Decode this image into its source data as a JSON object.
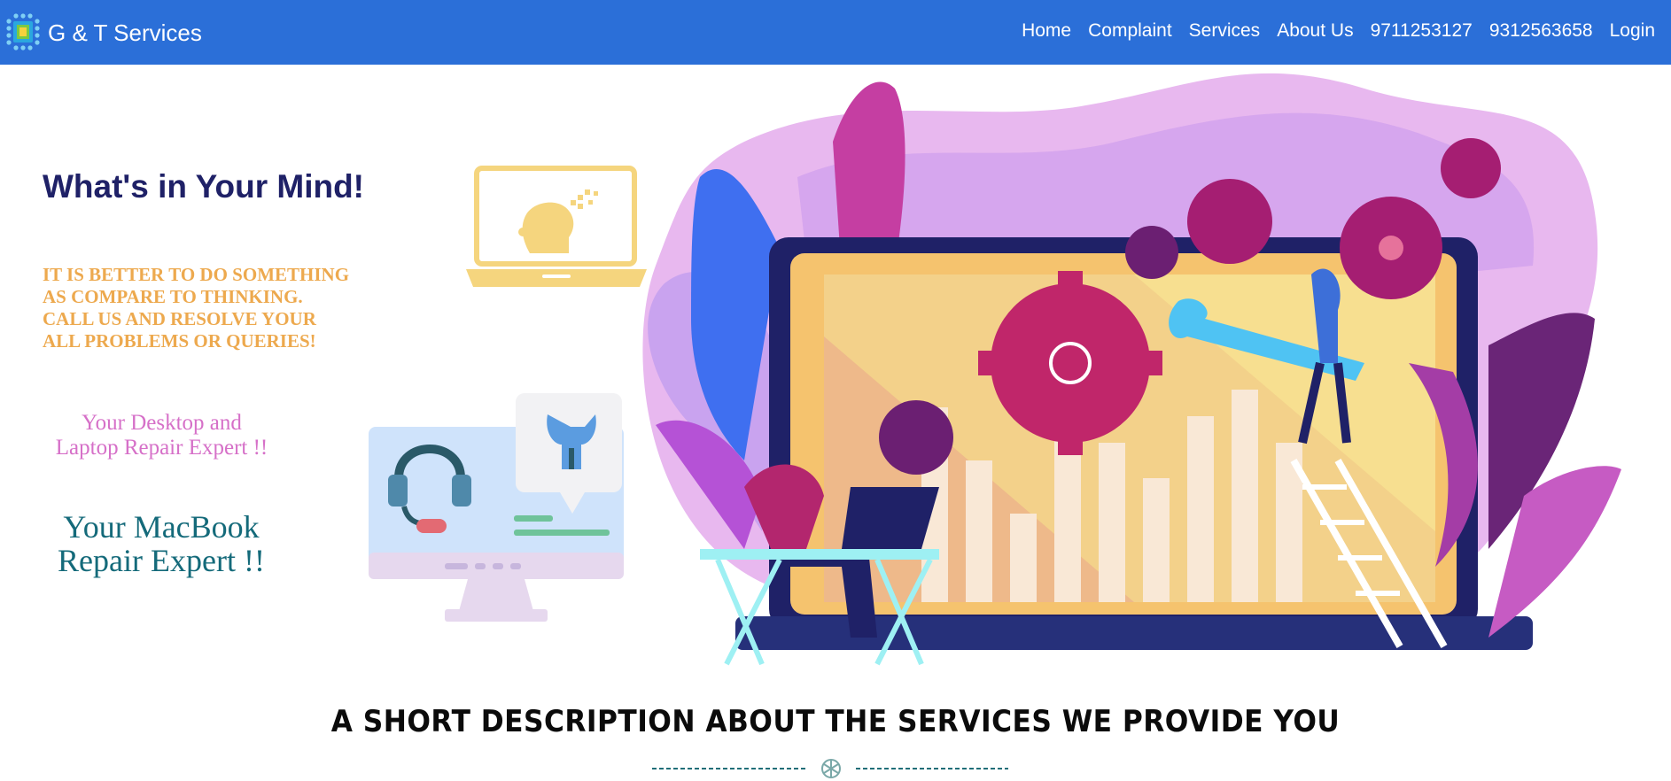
{
  "brand": {
    "name": "G & T Services",
    "logo_icon": "chip-icon"
  },
  "nav": {
    "items": [
      {
        "label": "Home"
      },
      {
        "label": "Complaint"
      },
      {
        "label": "Services"
      },
      {
        "label": "About Us"
      },
      {
        "label": "9711253127"
      },
      {
        "label": "9312563658"
      },
      {
        "label": "Login"
      }
    ]
  },
  "hero": {
    "title": "What's in Your Mind!",
    "quote_lines": [
      "IT IS BETTER TO DO SOMETHING",
      "AS COMPARE TO THINKING.",
      "CALL US AND RESOLVE YOUR",
      "ALL PROBLEMS OR QUERIES!"
    ],
    "expert_line1": [
      "Your Desktop and",
      "Laptop Repair Expert !!"
    ],
    "expert_line2": [
      "Your MacBook",
      "Repair Expert !!"
    ]
  },
  "section": {
    "heading": "A SHORT DESCRIPTION ABOUT THE SERVICES WE PROVIDE YOU",
    "divider_icon": "snowflake-icon"
  },
  "colors": {
    "navbar": "#2b6fd8",
    "title": "#1f2167",
    "quote": "#eda94e",
    "expert1": "#d670c8",
    "expert2": "#146a7a"
  }
}
